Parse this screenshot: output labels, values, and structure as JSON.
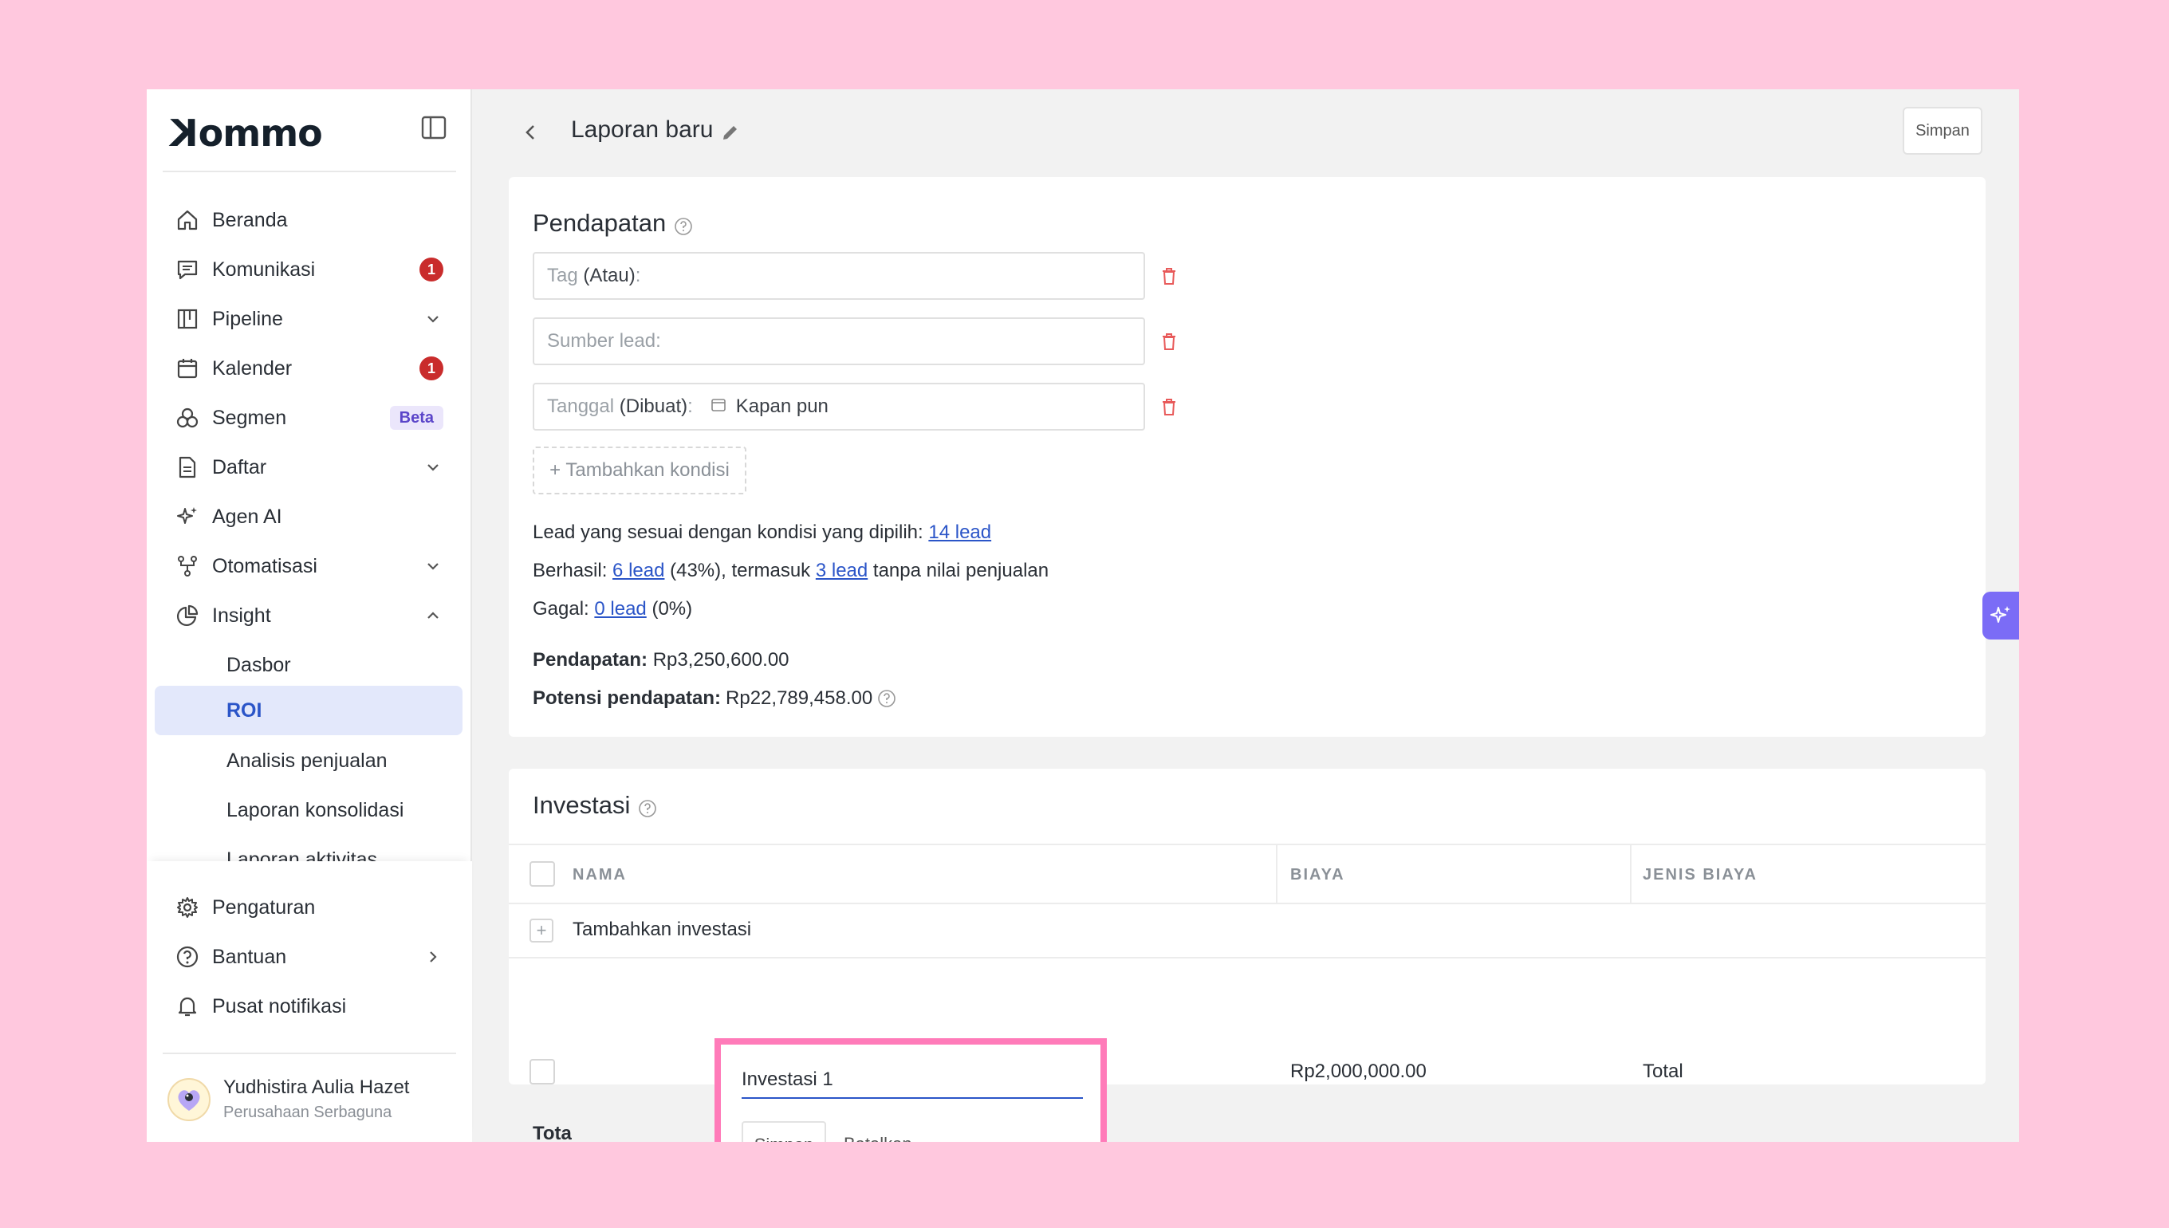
{
  "app": {
    "logo": "Kommo",
    "accent": "#2b55c8",
    "frame_bg": "#ffc8de",
    "highlight": "#ff7bb9"
  },
  "sidebar": {
    "items": [
      {
        "label": "Beranda",
        "icon": "home-icon"
      },
      {
        "label": "Komunikasi",
        "icon": "chat-icon",
        "badge": "1"
      },
      {
        "label": "Pipeline",
        "icon": "pipeline-icon"
      },
      {
        "label": "Kalender",
        "icon": "calendar-icon",
        "badge": "1"
      },
      {
        "label": "Segmen",
        "icon": "segment-icon",
        "tag": "Beta"
      },
      {
        "label": "Daftar",
        "icon": "document-icon"
      },
      {
        "label": "Agen AI",
        "icon": "sparkle-icon"
      },
      {
        "label": "Otomatisasi",
        "icon": "automation-icon"
      },
      {
        "label": "Insight",
        "icon": "pie-chart-icon"
      }
    ],
    "insight_sub": [
      "Dasbor",
      "ROI",
      "Analisis penjualan",
      "Laporan konsolidasi",
      "Laporan aktivitas"
    ],
    "bottom": [
      {
        "label": "Pengaturan",
        "icon": "gear-icon"
      },
      {
        "label": "Bantuan",
        "icon": "help-icon"
      },
      {
        "label": "Pusat notifikasi",
        "icon": "bell-icon"
      }
    ],
    "user": {
      "name": "Yudhistira Aulia Hazet",
      "org": "Perusahaan Serbaguna"
    }
  },
  "header": {
    "title": "Laporan baru",
    "save": "Simpan"
  },
  "revenue": {
    "title": "Pendapatan",
    "filters": {
      "tag_muted": "Tag",
      "tag_dark": "(Atau)",
      "tag_colon": ":",
      "source": "Sumber lead:",
      "date_muted": "Tanggal",
      "date_dark": "(Dibuat)",
      "date_colon": ":",
      "date_value": "Kapan pun"
    },
    "add_condition": "+ Tambahkan kondisi",
    "matching_prefix": "Lead yang sesuai dengan kondisi yang dipilih:",
    "matching_link": "14 lead",
    "won_prefix": "Berhasil:",
    "won_link": "6 lead",
    "won_mid": "(43%), termasuk",
    "won_link2": "3 lead",
    "won_suffix": "tanpa nilai penjualan",
    "lost_prefix": "Gagal:",
    "lost_link": "0 lead",
    "lost_suffix": "(0%)",
    "revenue_label": "Pendapatan:",
    "revenue_value": "Rp3,250,600.00",
    "potential_label": "Potensi pendapatan:",
    "potential_value": "Rp22,789,458.00"
  },
  "investment": {
    "title": "Investasi",
    "columns": [
      "NAMA",
      "BIAYA",
      "JENIS BIAYA"
    ],
    "add_label": "Tambahkan investasi",
    "row": {
      "name": "Investasi 1",
      "cost": "Rp2,000,000.00",
      "type": "Total"
    },
    "total_label": "Tota",
    "editor_save": "Simpan",
    "editor_cancel": "Batalkan"
  }
}
